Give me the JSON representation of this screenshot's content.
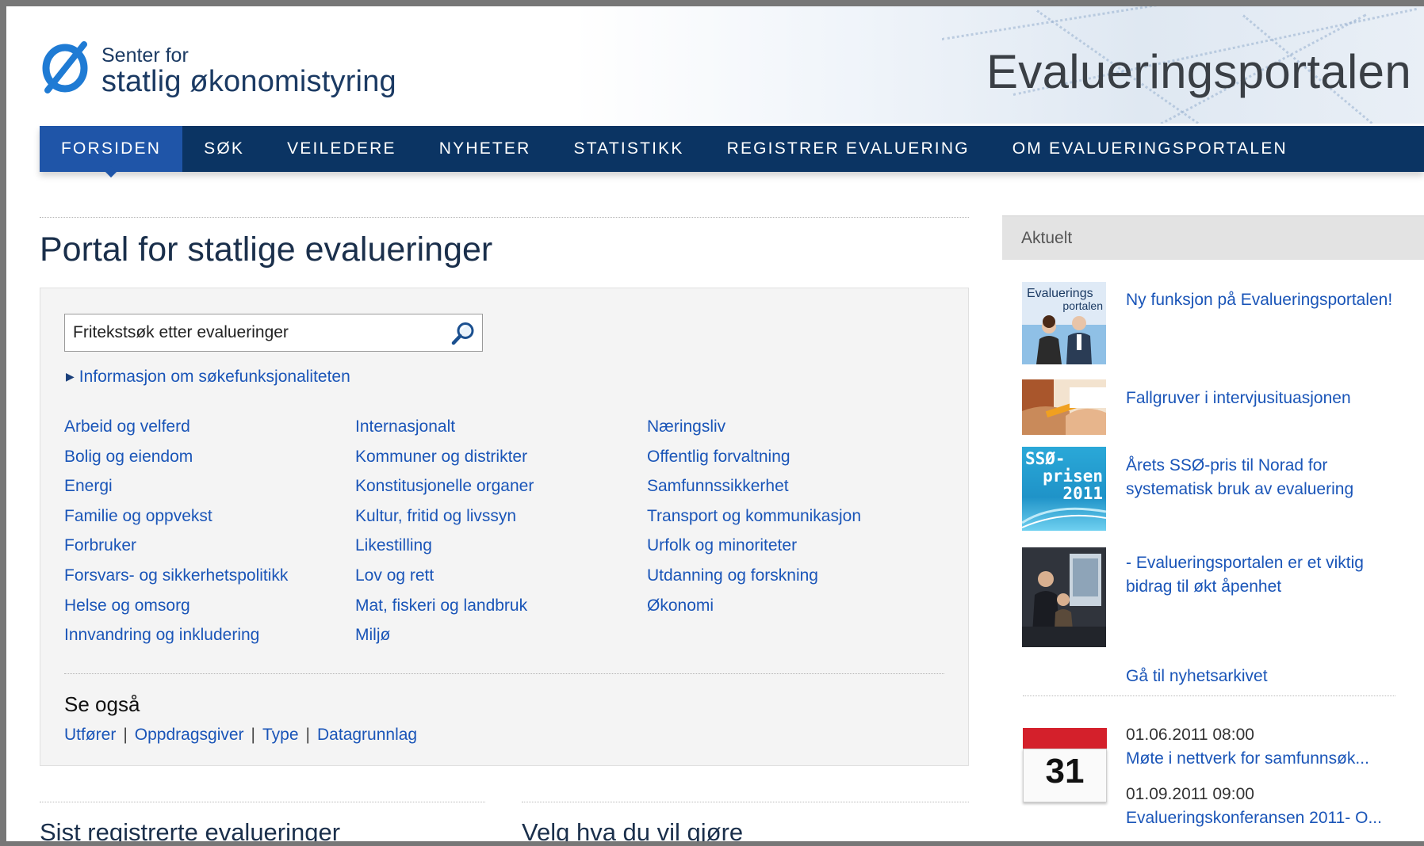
{
  "header": {
    "logo_line1": "Senter for",
    "logo_line2": "statlig økonomistyring",
    "portal_title": "Evalueringsportalen"
  },
  "nav": {
    "items": [
      {
        "label": "FORSIDEN",
        "active": true
      },
      {
        "label": "SØK"
      },
      {
        "label": "VEILEDERE"
      },
      {
        "label": "NYHETER"
      },
      {
        "label": "STATISTIKK"
      },
      {
        "label": "REGISTRER EVALUERING"
      },
      {
        "label": "OM EVALUERINGSPORTALEN"
      }
    ]
  },
  "main": {
    "title": "Portal for statlige evalueringer",
    "search": {
      "value": "Fritekstsøk etter evalueringer"
    },
    "info_link": "Informasjon om søkefunksjonaliteten",
    "topics": {
      "col1": [
        "Arbeid og velferd",
        "Bolig og eiendom",
        "Energi",
        "Familie og oppvekst",
        "Forbruker",
        "Forsvars- og sikkerhetspolitikk",
        "Helse og omsorg",
        "Innvandring og inkludering"
      ],
      "col2": [
        "Internasjonalt",
        "Kommuner og distrikter",
        "Konstitusjonelle organer",
        "Kultur, fritid og livssyn",
        "Likestilling",
        "Lov og rett",
        "Mat, fiskeri og landbruk",
        "Miljø"
      ],
      "col3": [
        "Næringsliv",
        "Offentlig forvaltning",
        "Samfunnssikkerhet",
        "Transport og kommunikasjon",
        "Urfolk og minoriteter",
        "Utdanning og forskning",
        "Økonomi"
      ]
    },
    "see_also": {
      "title": "Se også",
      "links": [
        "Utfører",
        "Oppdragsgiver",
        "Type",
        "Datagrunnlag"
      ],
      "separator": "|"
    },
    "bottom_left_title": "Sist registrerte evalueringer",
    "bottom_right_title": "Velg hva du vil gjøre"
  },
  "sidebar": {
    "heading": "Aktuelt",
    "news": [
      {
        "title": "Ny funksjon på Evalueringsportalen!"
      },
      {
        "title": "Fallgruver i intervjusituasjonen"
      },
      {
        "title": "Årets SSØ-pris til Norad for systematisk bruk av evaluering"
      },
      {
        "title": "- Evalueringsportalen er et viktig bidrag til økt åpenhet"
      }
    ],
    "thumb1_text": {
      "line1": "Evaluerings",
      "line2": "portalen"
    },
    "thumb3_text": {
      "line1": "SSØ-",
      "line2": "prisen",
      "line3": "2011"
    },
    "archive_link": "Gå til nyhetsarkivet",
    "calendar_day": "31",
    "events": [
      {
        "date": "01.06.2011 08:00",
        "title": "Møte i nettverk for samfunnsøk..."
      },
      {
        "date": "01.09.2011 09:00",
        "title": "Evalueringskonferansen 2011- O..."
      }
    ]
  },
  "colors": {
    "nav_bg": "#0b3463",
    "nav_active": "#1f55a8",
    "link": "#1a55b8",
    "calendar_red": "#d4202b"
  }
}
